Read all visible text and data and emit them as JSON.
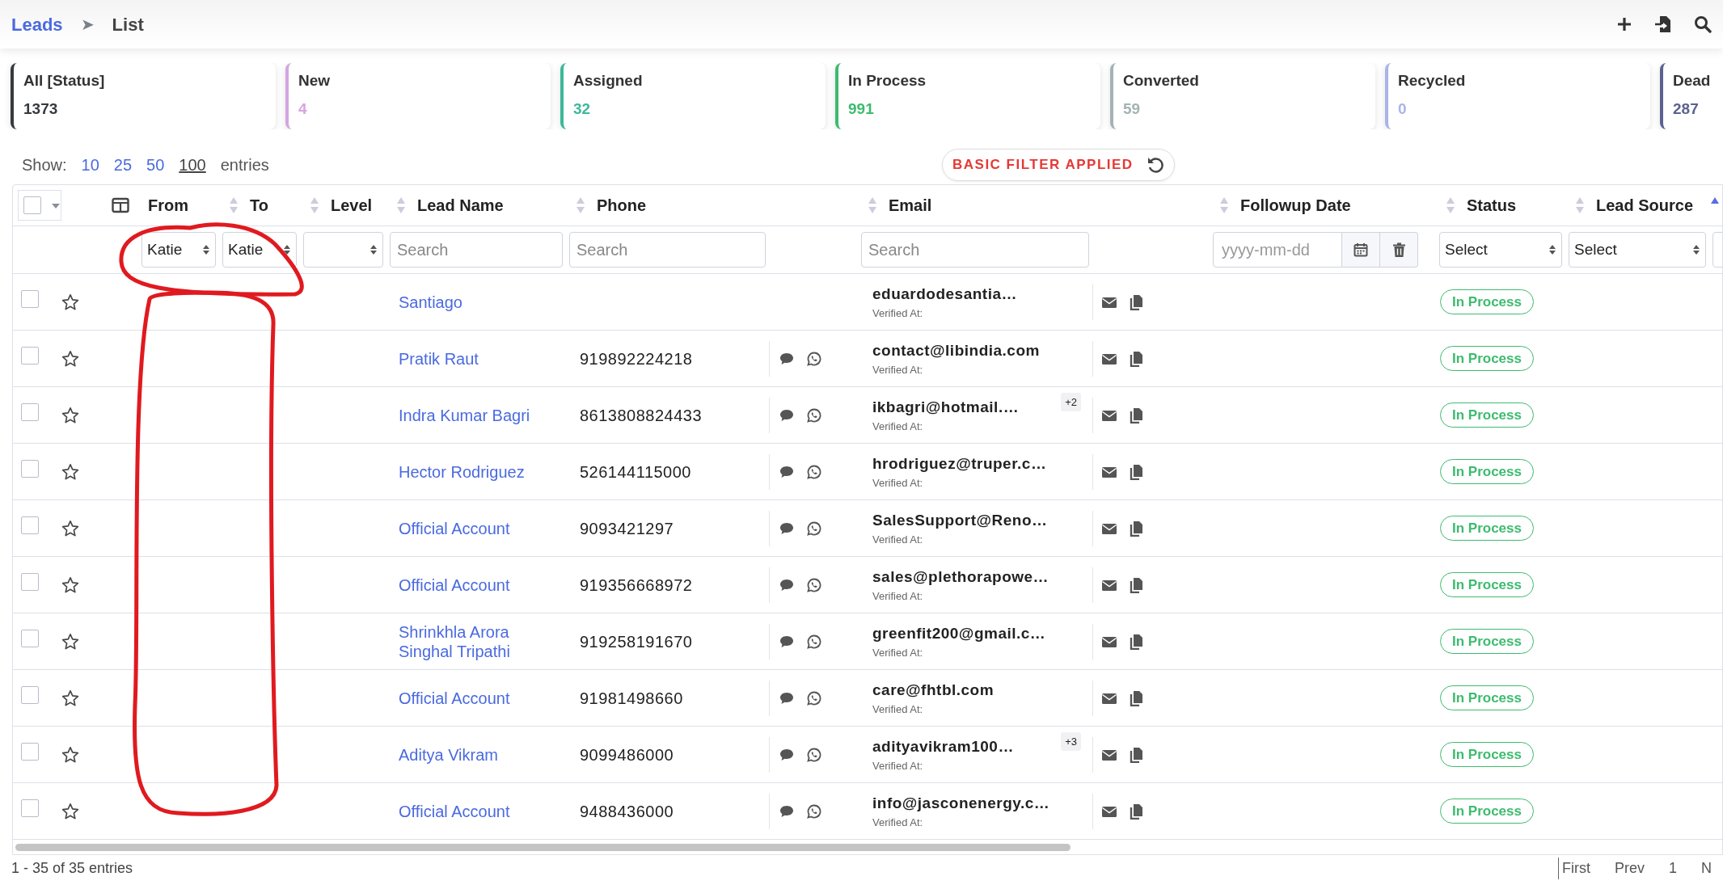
{
  "breadcrumb": {
    "items": [
      {
        "label": "Leads",
        "link": true
      },
      {
        "label": "List",
        "link": false
      }
    ],
    "separator": "➤"
  },
  "status_cards": [
    {
      "label": "All [Status]",
      "count": "1373",
      "color": "#343a40"
    },
    {
      "label": "New",
      "count": "4",
      "color": "#d4a5e0"
    },
    {
      "label": "Assigned",
      "count": "32",
      "color": "#3db89a"
    },
    {
      "label": "In Process",
      "count": "991",
      "color": "#3dbb6e"
    },
    {
      "label": "Converted",
      "count": "59",
      "color": "#a3b3b3"
    },
    {
      "label": "Recycled",
      "count": "0",
      "color": "#aab4e8"
    },
    {
      "label": "Dead",
      "count": "287",
      "color": "#5b6290"
    }
  ],
  "page_length": {
    "label": "Show:",
    "options": [
      {
        "label": "10",
        "selected": false
      },
      {
        "label": "25",
        "selected": false
      },
      {
        "label": "50",
        "selected": false
      },
      {
        "label": "100",
        "selected": true
      }
    ],
    "suffix": "entries"
  },
  "filter_badge": {
    "label": "BASIC FILTER APPLIED"
  },
  "table": {
    "select_all": {
      "checked": false
    },
    "columns": [
      {
        "label": "From",
        "filter": {
          "kind": "select",
          "value": "Katie"
        }
      },
      {
        "label": "To",
        "sorted_ascending": false,
        "filter": {
          "kind": "select",
          "value": "Katie"
        }
      },
      {
        "label": "Level",
        "sorted_ascending": false,
        "filter": {
          "kind": "select"
        }
      },
      {
        "label": "Lead Name",
        "sorted_ascending": false,
        "filter": {
          "kind": "search",
          "placeholder": "Search"
        }
      },
      {
        "label": "Phone",
        "sorted_ascending": false,
        "filter": {
          "kind": "search",
          "placeholder": "Search"
        }
      },
      {
        "label": "Email",
        "sorted_ascending": false,
        "filter": {
          "kind": "search",
          "placeholder": "Search"
        }
      },
      {
        "label": "Followup Date",
        "sorted_ascending": false,
        "filter": {
          "kind": "date",
          "placeholder": "yyyy-mm-dd"
        }
      },
      {
        "label": "Status",
        "sorted_ascending": false,
        "filter": {
          "kind": "select",
          "value": "Select"
        }
      },
      {
        "label": "Lead Source",
        "sorted_ascending": false,
        "filter": {
          "kind": "select",
          "value": "Select"
        }
      },
      {
        "sorted_ascending": true,
        "filter": {
          "kind": "select"
        }
      }
    ],
    "rows": [
      {
        "checked": false,
        "starred": false,
        "lead_name": "Santiago",
        "email": "eduardodesantia…",
        "verified_label": "Verified At:",
        "status": "In Process"
      },
      {
        "checked": false,
        "starred": false,
        "lead_name": "Pratik Raut",
        "phone": "919892224218",
        "email": "contact@libindia.com",
        "verified_label": "Verified At:",
        "status": "In Process"
      },
      {
        "checked": false,
        "starred": false,
        "lead_name": "Indra Kumar Bagri",
        "phone": "8613808824433",
        "email": "ikbagri@hotmail.…",
        "extra_emails": "+2",
        "verified_label": "Verified At:",
        "status": "In Process"
      },
      {
        "checked": false,
        "starred": false,
        "lead_name": "Hector Rodriguez",
        "phone": "526144115000",
        "email": "hrodriguez@truper.c…",
        "verified_label": "Verified At:",
        "status": "In Process"
      },
      {
        "checked": false,
        "starred": false,
        "lead_name": "Official Account",
        "phone": "9093421297",
        "email": "SalesSupport@Reno…",
        "verified_label": "Verified At:",
        "status": "In Process"
      },
      {
        "checked": false,
        "starred": false,
        "lead_name": "Official Account",
        "phone": "919356668972",
        "email": "sales@plethorapowe…",
        "verified_label": "Verified At:",
        "status": "In Process"
      },
      {
        "checked": false,
        "starred": false,
        "lead_name": "Shrinkhla Arora Singhal Tripathi",
        "phone": "919258191670",
        "email": "greenfit200@gmail.c…",
        "verified_label": "Verified At:",
        "status": "In Process"
      },
      {
        "checked": false,
        "starred": false,
        "lead_name": "Official Account",
        "phone": "91981498660",
        "email": "care@fhtbl.com",
        "verified_label": "Verified At:",
        "status": "In Process"
      },
      {
        "checked": false,
        "starred": false,
        "lead_name": "Aditya Vikram",
        "phone": "9099486000",
        "email": "adityavikram100…",
        "extra_emails": "+3",
        "verified_label": "Verified At:",
        "status": "In Process"
      },
      {
        "checked": false,
        "starred": false,
        "lead_name": "Official Account",
        "phone": "9488436000",
        "email": "info@jasconenergy.c…",
        "verified_label": "Verified At:",
        "status": "In Process"
      }
    ]
  },
  "footer": {
    "info": "1 - 35 of 35 entries",
    "pagination": [
      "First",
      "Prev",
      "1",
      "N"
    ]
  }
}
